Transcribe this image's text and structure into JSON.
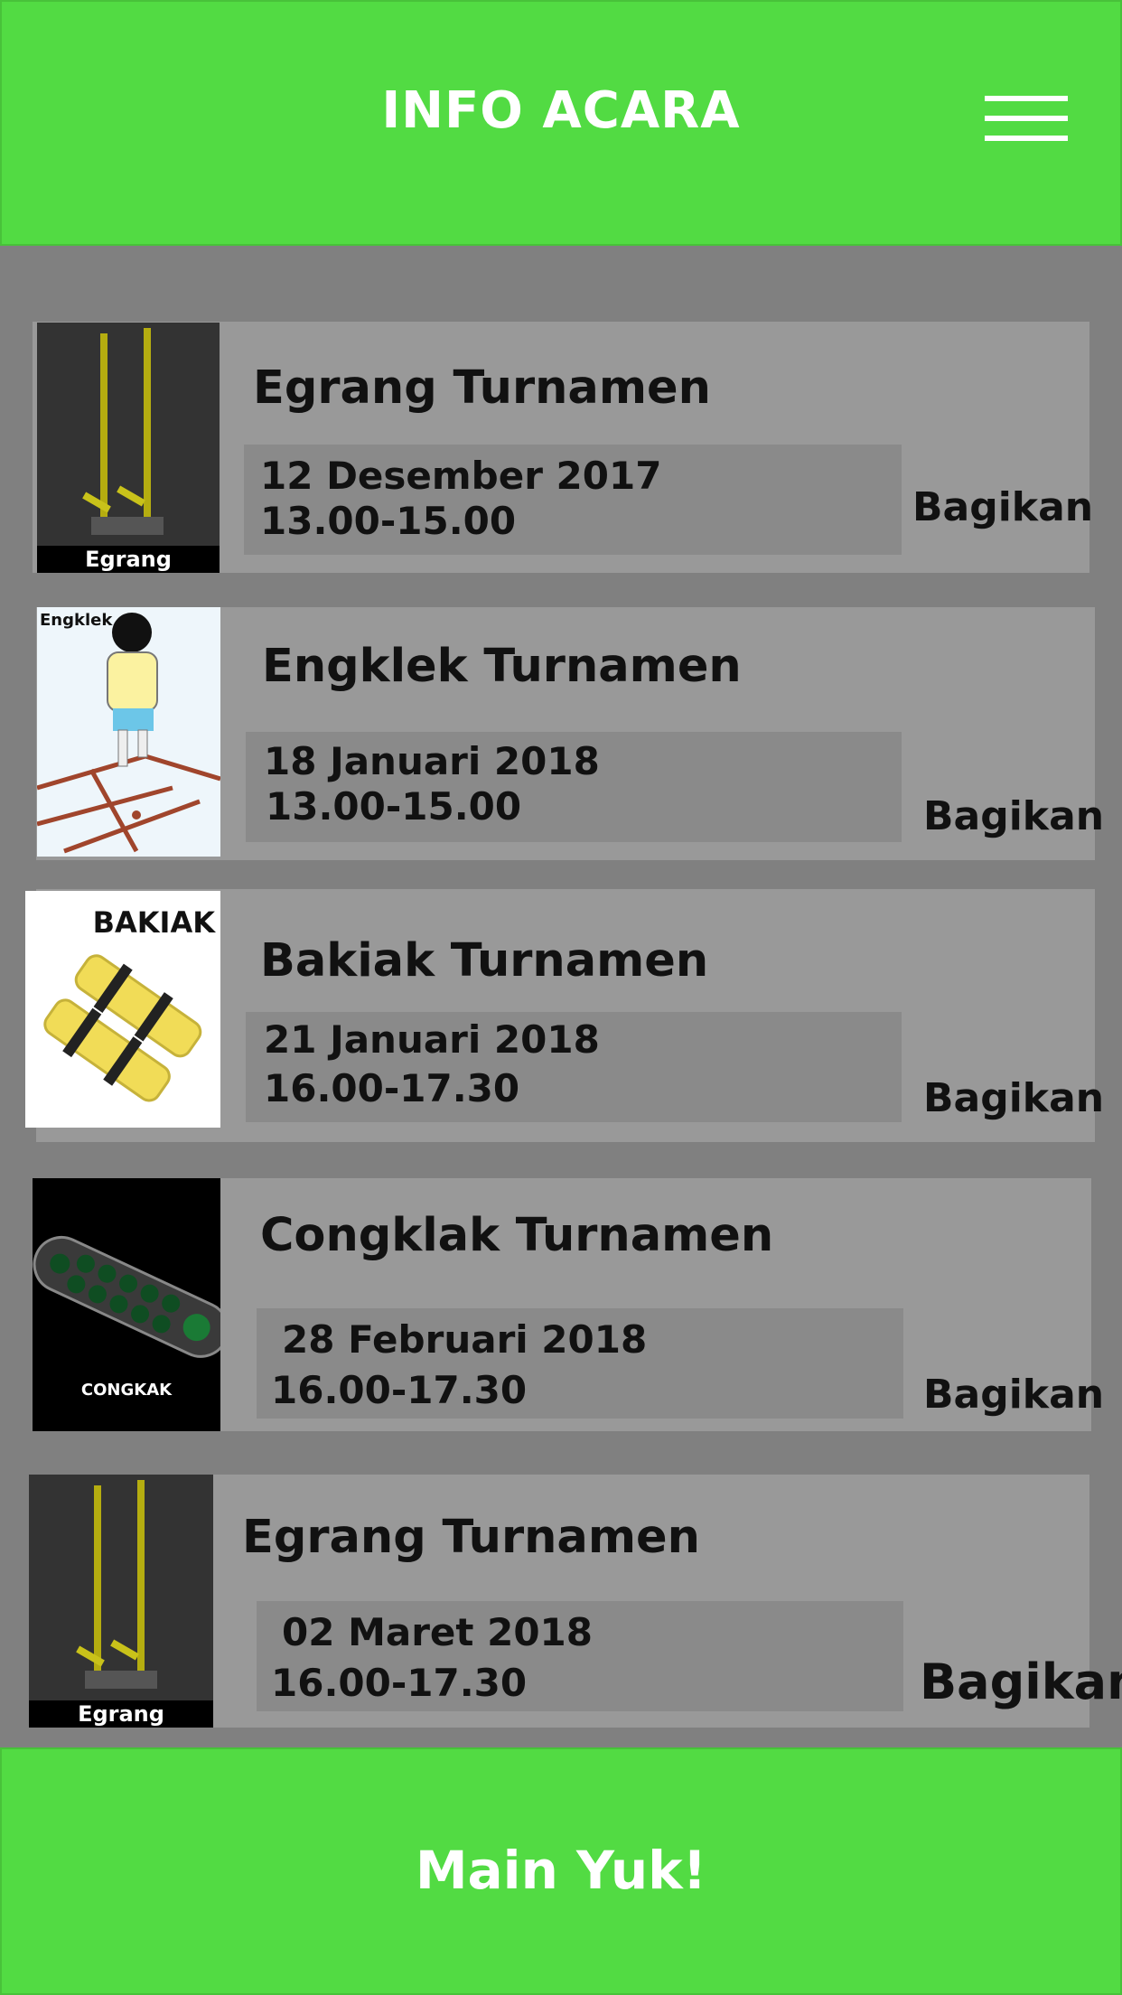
{
  "header": {
    "title": "INFO ACARA"
  },
  "events": [
    {
      "title": "Egrang Turnamen",
      "date": "12 Desember 2017",
      "time": "13.00-15.00",
      "share_label": "Bagikan",
      "thumb_label": "Egrang",
      "thumb_icon": "egrang-stilts-icon"
    },
    {
      "title": "Engklek Turnamen",
      "date": "18  Januari 2018",
      "time": "13.00-15.00",
      "share_label": "Bagikan",
      "thumb_label": "Engklek",
      "thumb_icon": "engklek-hopscotch-icon"
    },
    {
      "title": "Bakiak Turnamen",
      "date": "21  Januari 2018",
      "time": "16.00-17.30",
      "share_label": "Bagikan",
      "thumb_label": "BAKIAK",
      "thumb_icon": "bakiak-clogs-icon"
    },
    {
      "title": "Congklak Turnamen",
      "date": "28  Februari 2018",
      "time": "16.00-17.30",
      "share_label": "Bagikan",
      "thumb_label": "CONGKAK",
      "thumb_icon": "congklak-board-icon"
    },
    {
      "title": "Egrang Turnamen",
      "date": "02  Maret 2018",
      "time": "16.00-17.30",
      "share_label": "Bagikan",
      "thumb_label": "Egrang",
      "thumb_icon": "egrang-stilts-icon"
    }
  ],
  "footer": {
    "button_label": "Main Yuk!"
  },
  "colors": {
    "accent": "#52db43",
    "background": "#808080",
    "card": "#999999",
    "date_box": "#8a8a8a"
  }
}
